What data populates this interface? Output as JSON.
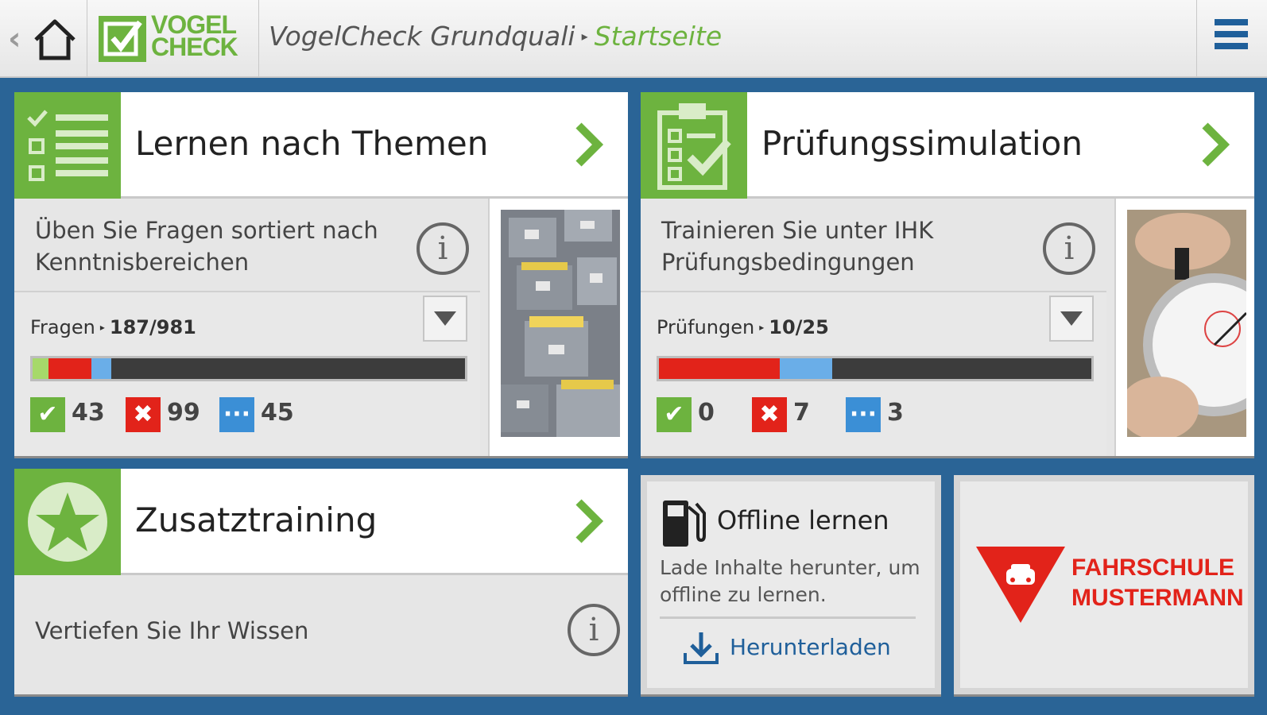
{
  "header": {
    "title": "VogelCheck Grundquali",
    "current_page": "Startseite",
    "logo": {
      "line1": "VOGEL",
      "line2": "CHECK"
    },
    "back_icon": "chevron-left-icon",
    "home_icon": "home-icon",
    "menu_icon": "hamburger-menu-icon"
  },
  "colors": {
    "brand_green": "#6db33f",
    "correct": "#6db33f",
    "wrong": "#e2231a",
    "open": "#3b8fd6",
    "header_blue": "#1f5f9a",
    "background": "#2a6496"
  },
  "cards": {
    "topics": {
      "title": "Lernen nach Themen",
      "description": "Üben Sie Fragen sortiert nach Kenntnisbereichen",
      "stat_label": "Fragen",
      "stat_value": "187/981",
      "progress_fraction": 0.19,
      "counts": {
        "correct": "43",
        "wrong": "99",
        "open": "45"
      },
      "icon": "checklist-icon",
      "image": "file-cabinet-image"
    },
    "exam": {
      "title": "Prüfungssimulation",
      "description": "Trainieren Sie unter IHK Prüfungsbedingungen",
      "stat_label": "Prüfungen",
      "stat_value": "10/25",
      "progress_fraction": 0.4,
      "counts": {
        "correct": "0",
        "wrong": "7",
        "open": "3"
      },
      "icon": "clipboard-check-icon",
      "image": "stopwatch-image"
    },
    "extra": {
      "title": "Zusatztraining",
      "description": "Vertiefen Sie Ihr Wissen",
      "icon": "star-icon"
    },
    "offline": {
      "title": "Offline lernen",
      "description": "Lade Inhalte herunter, um offline zu lernen.",
      "download_label": "Herunterladen",
      "icon": "fuel-pump-icon",
      "download_icon": "download-icon"
    },
    "school": {
      "line1": "FAHRSCHULE",
      "line2": "MUSTERMANN",
      "icon": "car-warning-triangle-icon"
    }
  }
}
